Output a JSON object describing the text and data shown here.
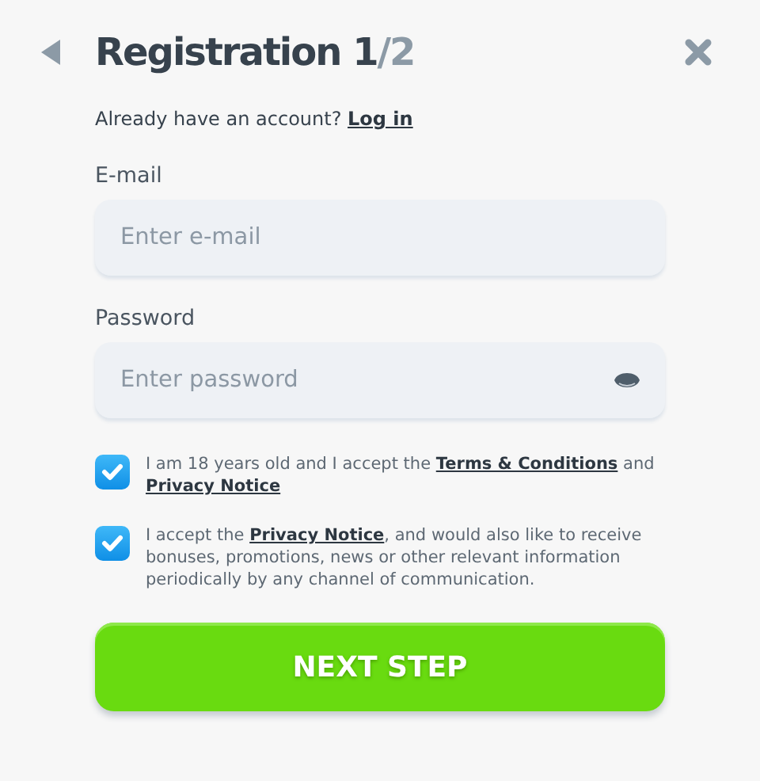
{
  "header": {
    "title": "Registration",
    "step": "1",
    "step_total": "/2"
  },
  "login_prompt": {
    "text": "Already have an account?",
    "link": "Log in"
  },
  "fields": [
    {
      "label": "E-mail",
      "placeholder": "Enter e-mail",
      "kind": "text"
    },
    {
      "label": "Password",
      "placeholder": "Enter password",
      "kind": "password"
    }
  ],
  "consents": [
    {
      "checked": true,
      "parts": [
        {
          "kind": "text",
          "text": "I am 18 years old and I accept the "
        },
        {
          "kind": "link",
          "text": "Terms & Conditions"
        },
        {
          "kind": "text",
          "text": " and "
        },
        {
          "kind": "link",
          "text": "Privacy Notice"
        }
      ]
    },
    {
      "checked": true,
      "parts": [
        {
          "kind": "text",
          "text": "I accept the "
        },
        {
          "kind": "link",
          "text": "Privacy Notice"
        },
        {
          "kind": "text",
          "text": ", and would also like to receive bonuses, promotions, news or other relevant information periodically by any channel of communication."
        }
      ]
    }
  ],
  "submit": "NEXT STEP"
}
